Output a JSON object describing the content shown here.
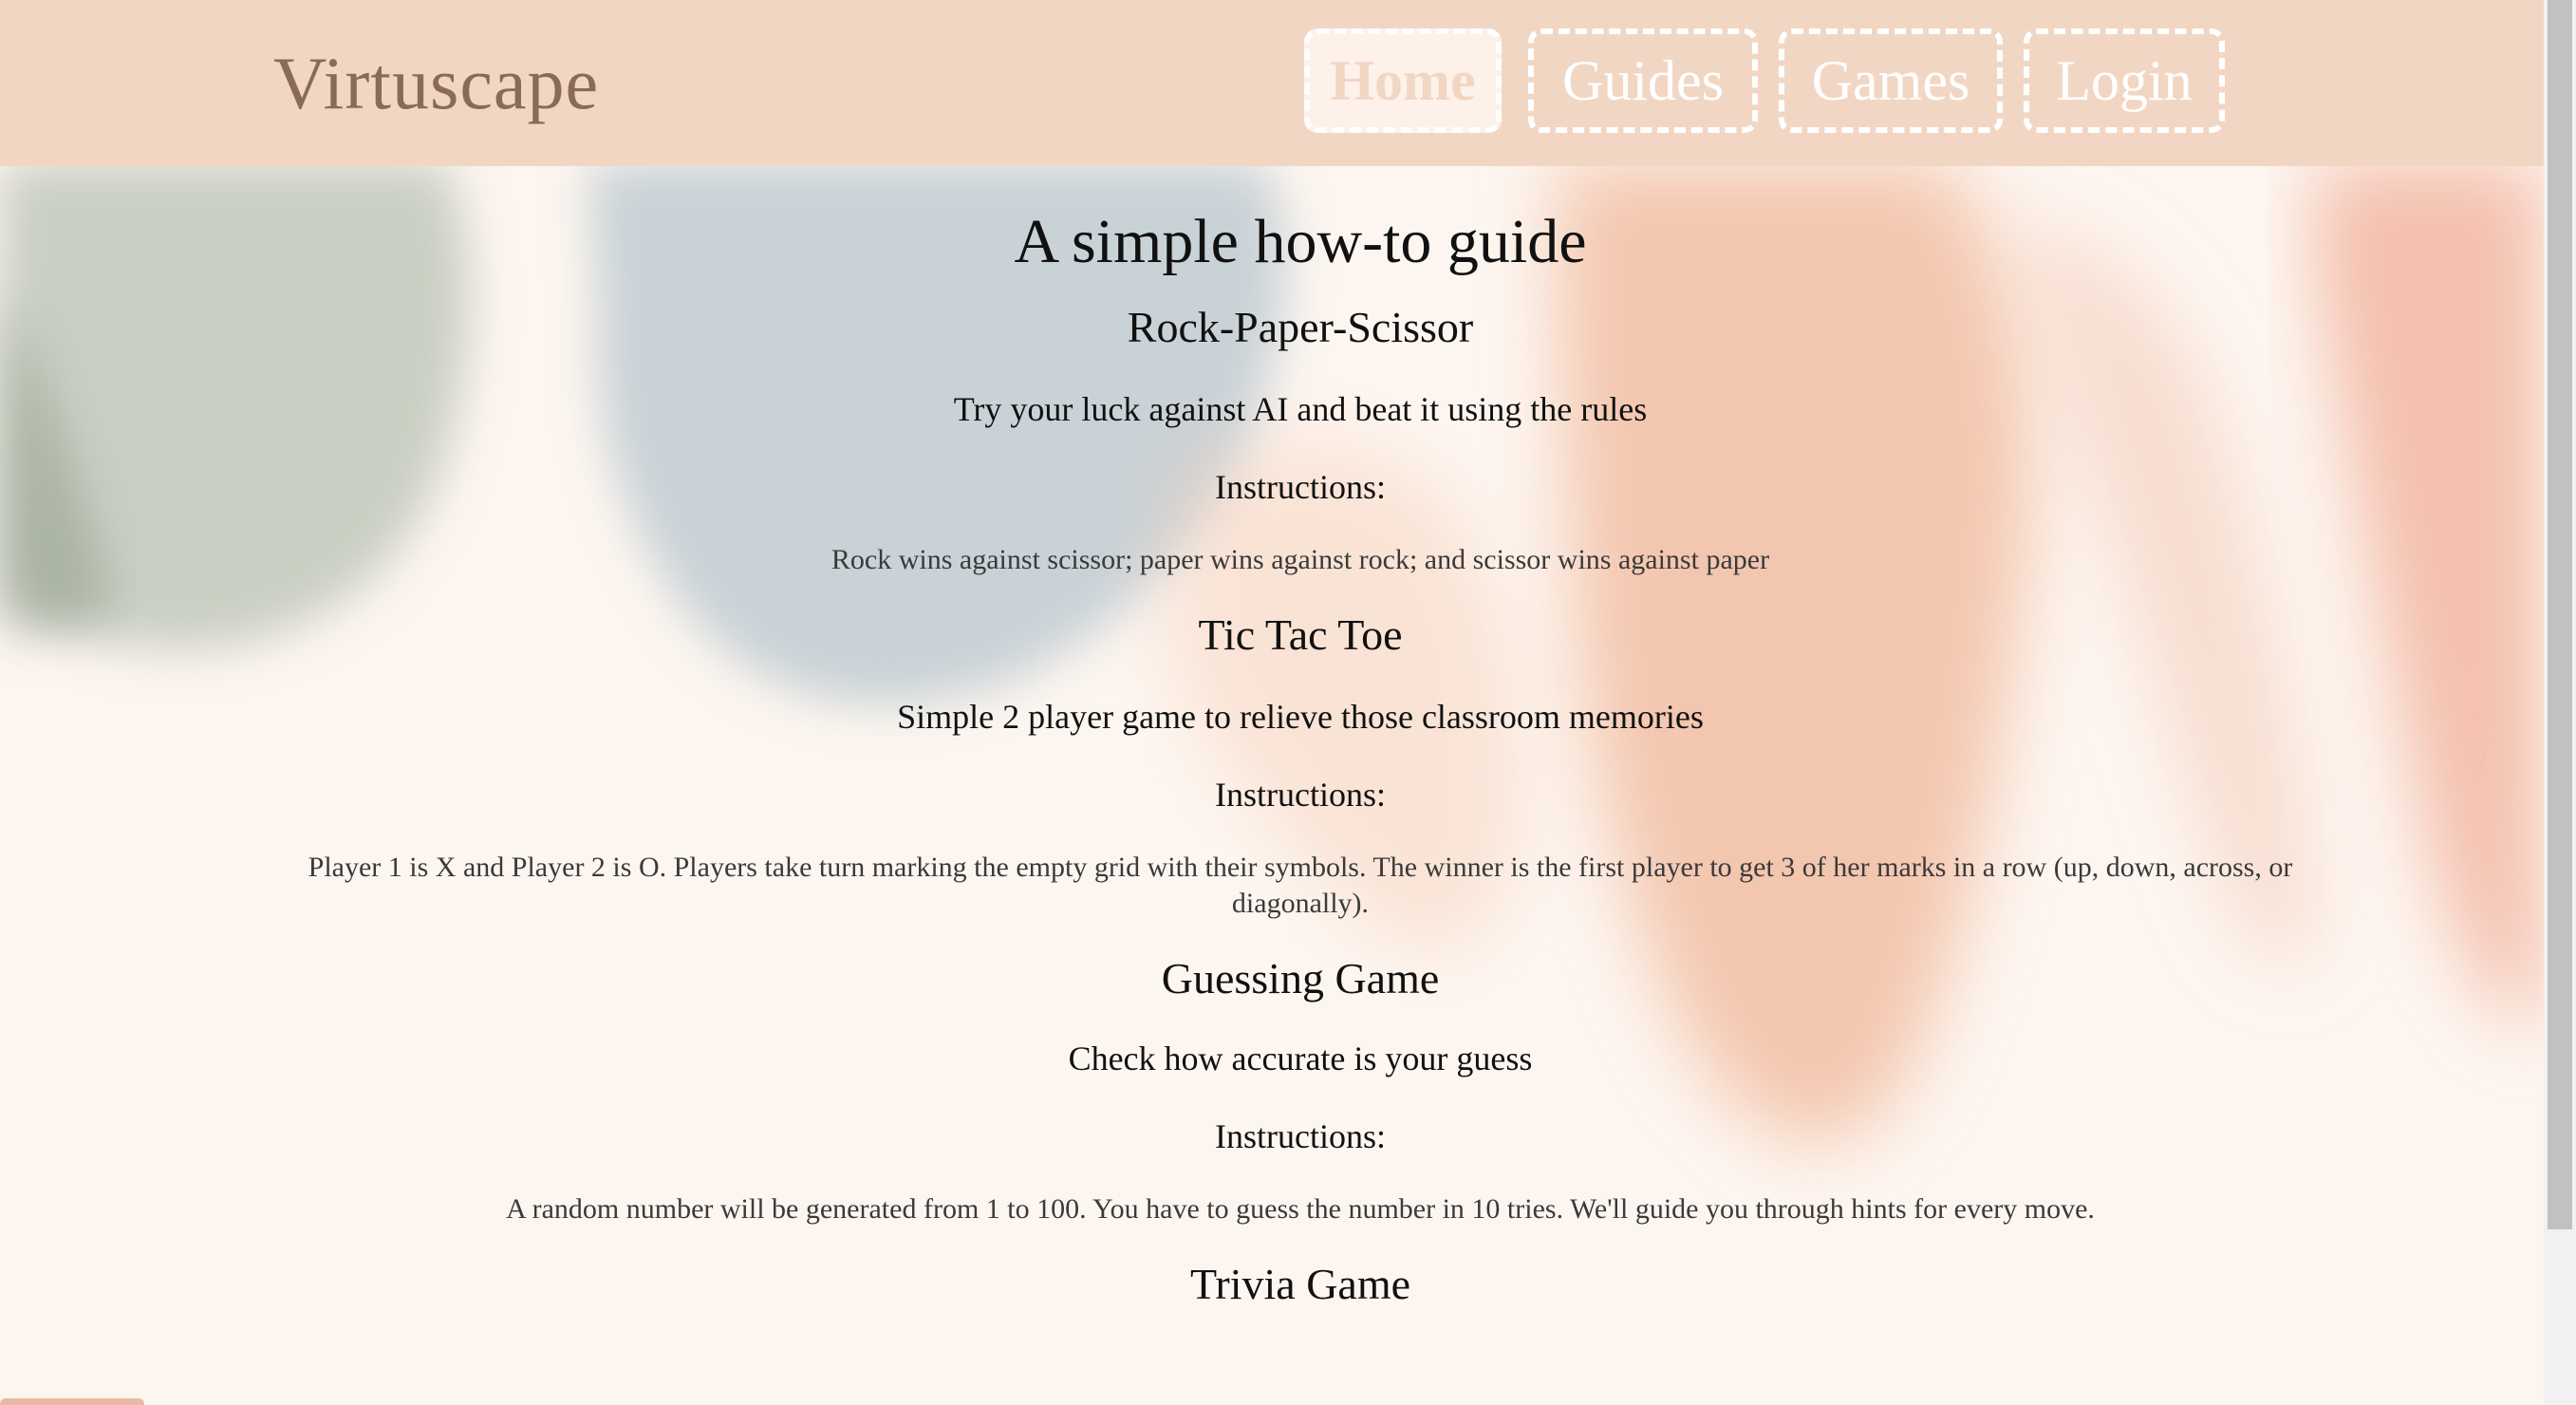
{
  "brand": "Virtuscape",
  "nav": {
    "home": "Home",
    "guides": "Guides",
    "games": "Games",
    "login": "Login"
  },
  "colors": {
    "navbar": "#f2d6c4",
    "background": "#fdf6f0",
    "brand_text": "#8a6a58",
    "nav_border": "#ffffff"
  },
  "main": {
    "title": "A simple how-to guide",
    "games": [
      {
        "name": "Rock-Paper-Scissor",
        "tagline": "Try your luck against AI and beat it using the rules",
        "instructions_label": "Instructions:",
        "instructions": "Rock wins against scissor; paper wins against rock; and scissor wins against paper"
      },
      {
        "name": "Tic Tac Toe",
        "tagline": "Simple 2 player game to relieve those classroom memories",
        "instructions_label": "Instructions:",
        "instructions": "Player 1 is X and Player 2 is O. Players take turn marking the empty grid with their symbols. The winner is the first player to get 3 of her marks in a row (up, down, across, or diagonally)."
      },
      {
        "name": "Guessing Game",
        "tagline": "Check how accurate is your guess",
        "instructions_label": "Instructions:",
        "instructions": "A random number will be generated from 1 to 100. You have to guess the number in 10 tries. We'll guide you through hints for every move."
      },
      {
        "name": "Trivia Game"
      }
    ]
  }
}
